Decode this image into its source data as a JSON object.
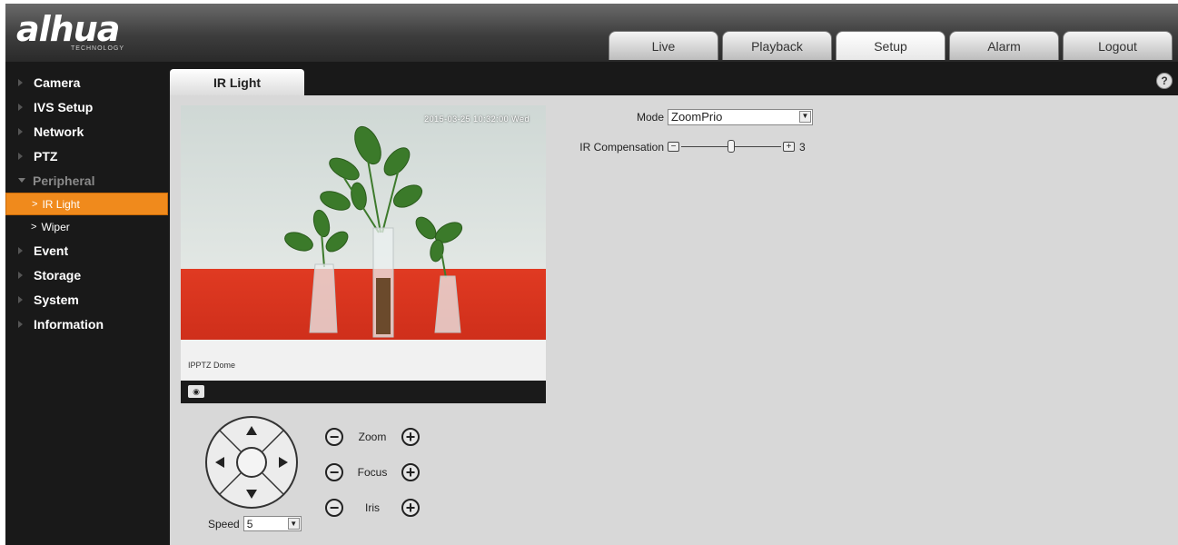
{
  "header": {
    "logo": "alhua",
    "logo_sub": "TECHNOLOGY",
    "nav": [
      "Live",
      "Playback",
      "Setup",
      "Alarm",
      "Logout"
    ],
    "active_nav": "Setup"
  },
  "sidebar": {
    "items": [
      {
        "label": "Camera"
      },
      {
        "label": "IVS Setup"
      },
      {
        "label": "Network"
      },
      {
        "label": "PTZ"
      },
      {
        "label": "Peripheral",
        "expanded": true
      },
      {
        "label": "IR Light",
        "sub": true,
        "active": true
      },
      {
        "label": "Wiper",
        "sub": true
      },
      {
        "label": "Event"
      },
      {
        "label": "Storage"
      },
      {
        "label": "System"
      },
      {
        "label": "Information"
      }
    ]
  },
  "page": {
    "tab": "IR Light",
    "help": "?"
  },
  "video": {
    "osd_top": "2015-03-25 10:32:00 Wed",
    "osd_bottom": "IPPTZ Dome",
    "snapshot_icon": "camera-icon"
  },
  "ptz": {
    "speed_label": "Speed",
    "speed_value": "5",
    "zoom_label": "Zoom",
    "focus_label": "Focus",
    "iris_label": "Iris"
  },
  "settings": {
    "mode_label": "Mode",
    "mode_value": "ZoomPrio",
    "ir_comp_label": "IR Compensation",
    "ir_comp_value": "3",
    "ir_comp_level": 0.5
  },
  "colors": {
    "accent": "#f08a1c",
    "sidebar_bg": "#191919",
    "content_bg": "#d8d8d8"
  }
}
